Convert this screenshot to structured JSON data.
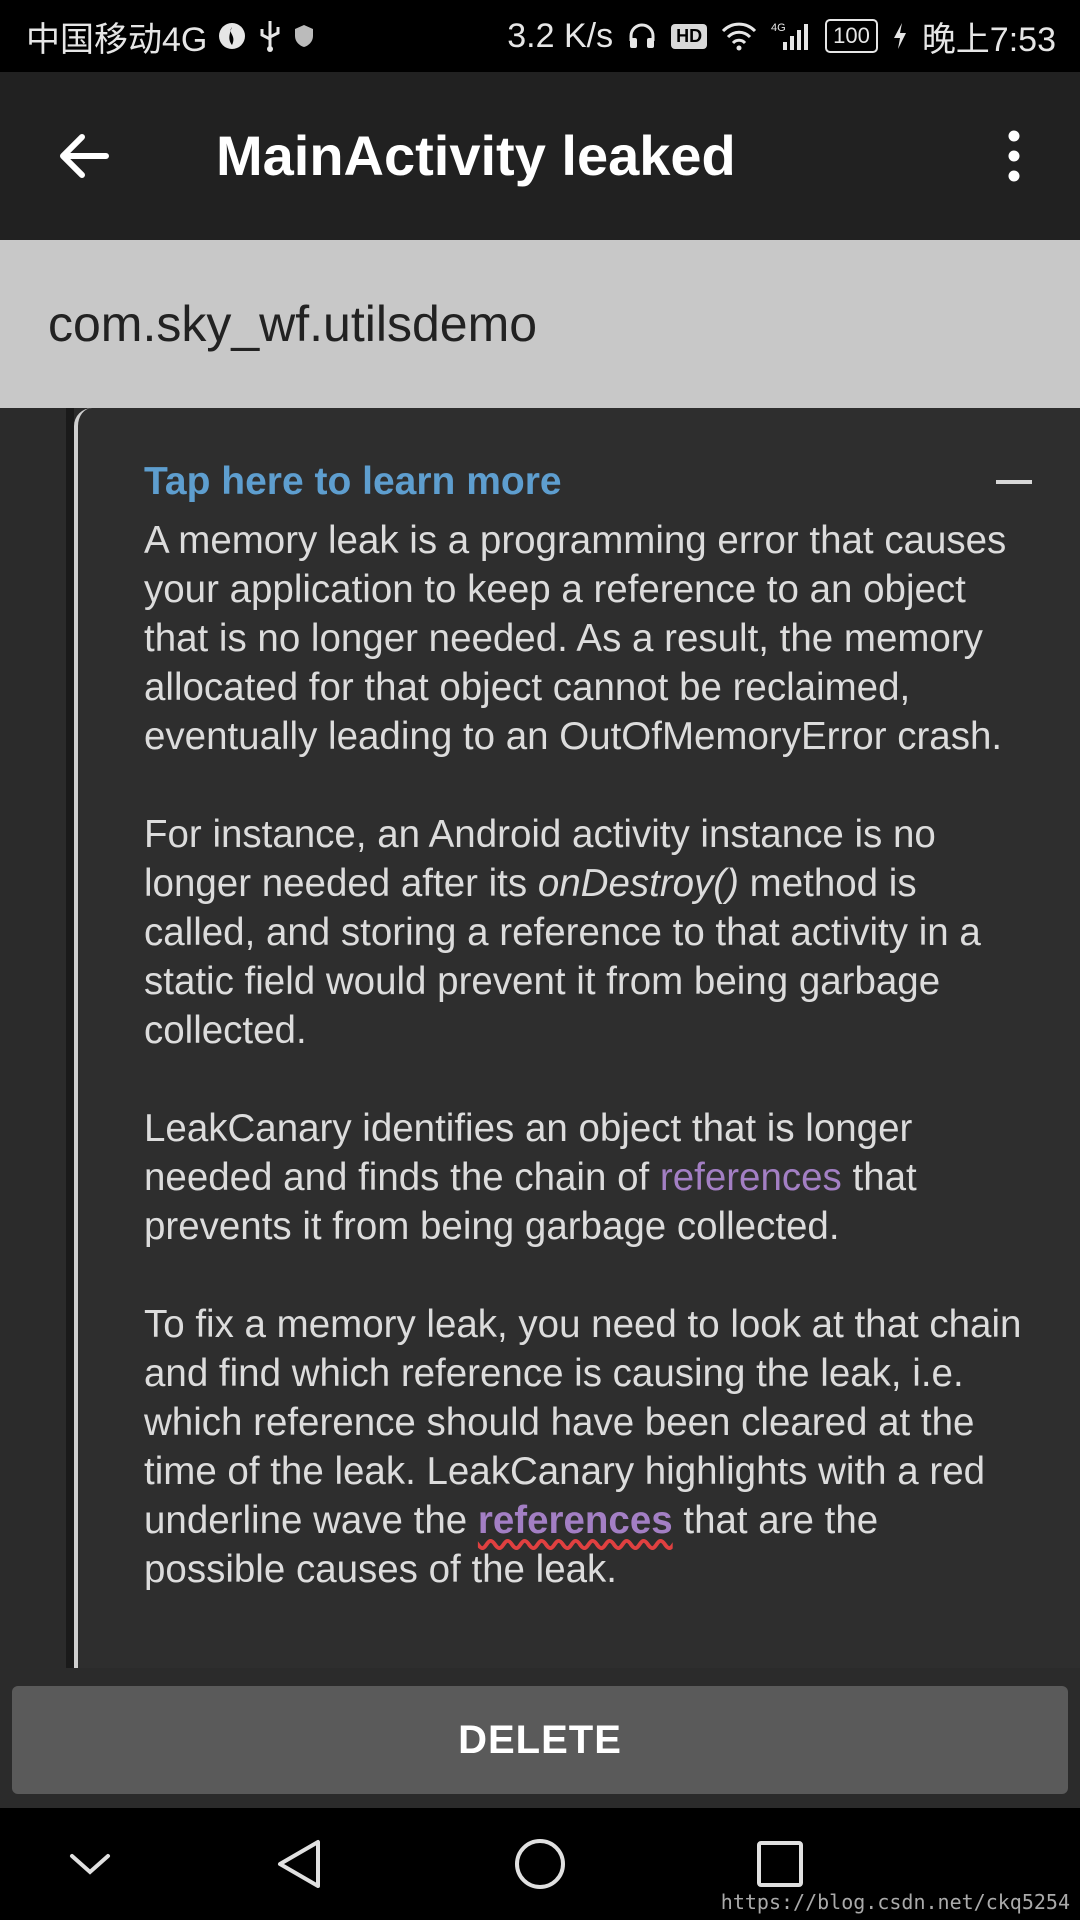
{
  "status_bar": {
    "carrier": "中国移动4G",
    "speed": "3.2 K/s",
    "hd": "HD",
    "network": "4G",
    "battery": "100",
    "time": "晚上7:53"
  },
  "app_bar": {
    "title": "MainActivity leaked",
    "back_icon": "arrow-back-icon",
    "menu_icon": "more-vert-icon"
  },
  "package": {
    "name": "com.sky_wf.utilsdemo"
  },
  "learn_more": {
    "title": "Tap here to learn more",
    "p1": "A memory leak is a programming error that causes your application to keep a reference to an object that is no longer needed. As a result, the memory allocated for that object cannot be reclaimed, eventually leading to an OutOfMemoryError crash.",
    "p2_a": "For instance, an Android activity instance is no longer needed after its ",
    "p2_em": "onDestroy()",
    "p2_b": " method is called, and storing a reference to that activity in a static field would prevent it from being garbage collected.",
    "p3_a": "LeakCanary identifies an object that is longer needed and finds the chain of ",
    "p3_link": "references",
    "p3_b": " that prevents it from being garbage collected.",
    "p4_a": "To fix a memory leak, you need to look at that chain and find which reference is causing the leak, i.e. which reference should have been cleared at the time of the leak. LeakCanary highlights with a red underline wave the ",
    "p4_link": "references",
    "p4_b": " that are the possible causes of the leak."
  },
  "actions": {
    "delete_label": "DELETE"
  },
  "nav_bar": {
    "icons": [
      "chevron-down-icon",
      "back-triangle-icon",
      "home-circle-icon",
      "recents-square-icon"
    ]
  },
  "watermark": "https://blog.csdn.net/ckq5254",
  "colors": {
    "link_blue": "#5e9ecf",
    "link_purple": "#a37fc4",
    "wave_red": "#e04040",
    "appbar": "#212121"
  }
}
